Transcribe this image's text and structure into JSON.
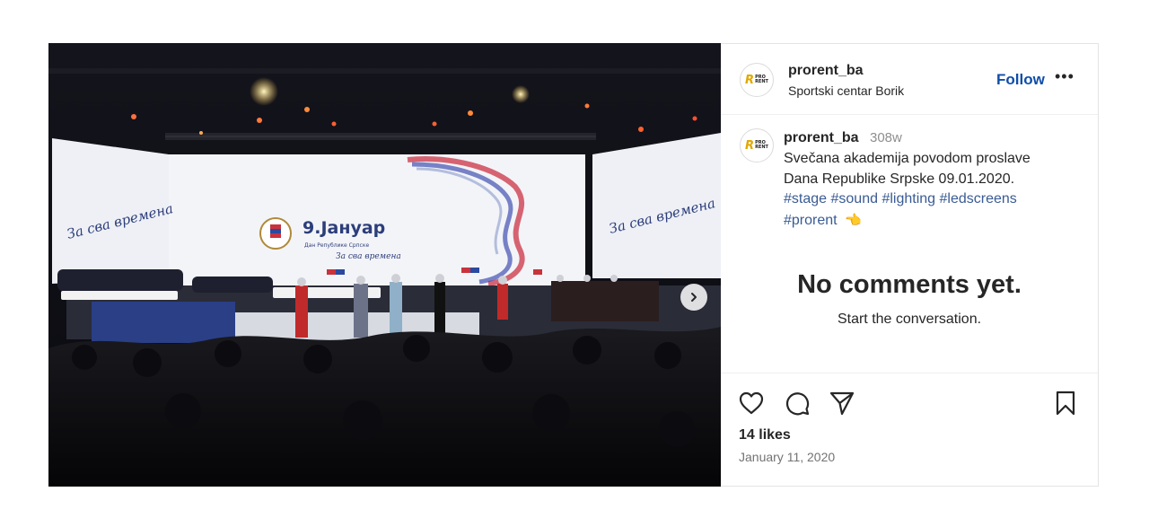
{
  "photo": {
    "stage_title": "9.Јануар",
    "stage_subtitle": "Дан Републике Српске",
    "stage_script": "За сва времена",
    "side_screen_script": "За сва времена"
  },
  "header": {
    "username": "prorent_ba",
    "location": "Sportski centar Borik",
    "follow_label": "Follow",
    "more_label": "•••",
    "logo_mark": "R",
    "logo_text_1": "PRO",
    "logo_text_2": "RENT"
  },
  "caption": {
    "username": "prorent_ba",
    "time": "308w",
    "line1": "Svečana akademija povodom proslave",
    "line2": "Dana Republike Srpske 09.01.2020.",
    "hashtags": [
      "#stage",
      "#sound",
      "#lighting",
      "#ledscreens",
      "#prorent"
    ],
    "emoji": "👈"
  },
  "comments": {
    "title": "No comments yet.",
    "subtitle": "Start the conversation."
  },
  "footer": {
    "likes": "14 likes",
    "date": "January 11, 2020"
  },
  "icons": {
    "like": "heart-icon",
    "comment": "comment-icon",
    "share": "share-icon",
    "save": "bookmark-icon",
    "next": "chevron-right-icon"
  }
}
